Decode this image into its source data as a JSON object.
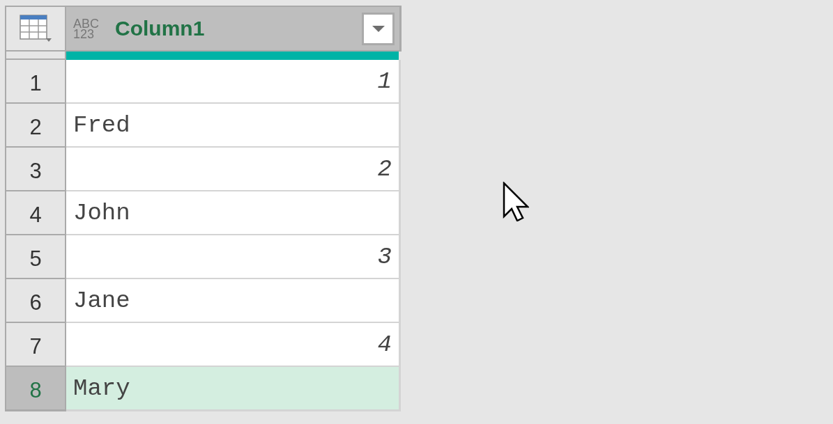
{
  "table": {
    "column": {
      "data_type": {
        "line_1": "ABC",
        "line_2": "123"
      },
      "name": "Column1",
      "quality_bar": {
        "level": 1
      }
    },
    "rows": [
      {
        "number": "1",
        "value": "1",
        "kind": "number",
        "selected": false
      },
      {
        "number": "2",
        "value": "Fred",
        "kind": "text",
        "selected": false
      },
      {
        "number": "3",
        "value": "2",
        "kind": "number",
        "selected": false
      },
      {
        "number": "4",
        "value": "John",
        "kind": "text",
        "selected": false
      },
      {
        "number": "5",
        "value": "3",
        "kind": "number",
        "selected": false
      },
      {
        "number": "6",
        "value": "Jane",
        "kind": "text",
        "selected": false
      },
      {
        "number": "7",
        "value": "4",
        "kind": "number",
        "selected": false
      },
      {
        "number": "8",
        "value": "Mary",
        "kind": "text",
        "selected": true
      }
    ]
  }
}
